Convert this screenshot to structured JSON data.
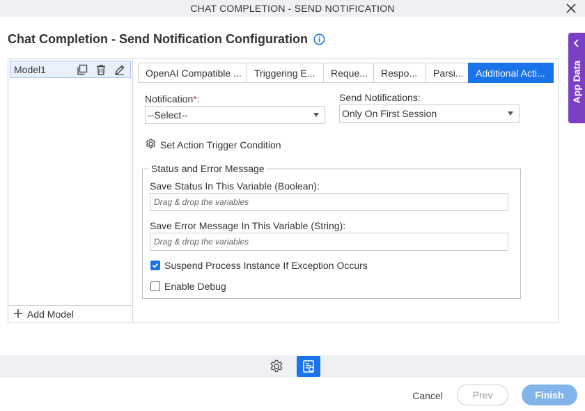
{
  "dialog": {
    "title": "CHAT COMPLETION - SEND NOTIFICATION"
  },
  "page": {
    "heading": "Chat Completion - Send Notification Configuration"
  },
  "app_data_tab": {
    "label": "App Data"
  },
  "models": {
    "items": [
      {
        "label": "Model1"
      }
    ],
    "add_label": "Add Model"
  },
  "tabs": [
    {
      "label": "OpenAI Compatible ...",
      "active": false
    },
    {
      "label": "Triggering E...",
      "active": false
    },
    {
      "label": "Reque...",
      "active": false
    },
    {
      "label": "Respo...",
      "active": false
    },
    {
      "label": "Parsi...",
      "active": false
    },
    {
      "label": "Additional Acti...",
      "active": true
    }
  ],
  "form": {
    "notification": {
      "label": "Notification",
      "required_mark": "*",
      "suffix": ":",
      "value": "--Select--"
    },
    "send_notifications": {
      "label": "Send Notifications:",
      "value": "Only On First Session"
    },
    "trigger_label": "Set Action Trigger Condition",
    "status_group": {
      "legend": "Status and Error Message",
      "save_status_label": "Save Status In This Variable (Boolean):",
      "save_status_placeholder": "Drag & drop the variables",
      "save_error_label": "Save Error Message In This Variable (String):",
      "save_error_placeholder": "Drag & drop the variables",
      "suspend_label": "Suspend Process Instance If Exception Occurs",
      "suspend_checked": true,
      "debug_label": "Enable Debug",
      "debug_checked": false
    }
  },
  "footer": {
    "cancel": "Cancel",
    "prev": "Prev",
    "finish": "Finish"
  },
  "colors": {
    "accent": "#1a73e8",
    "app_data": "#7b3fc4",
    "finish_disabled": "#82b4ec"
  }
}
